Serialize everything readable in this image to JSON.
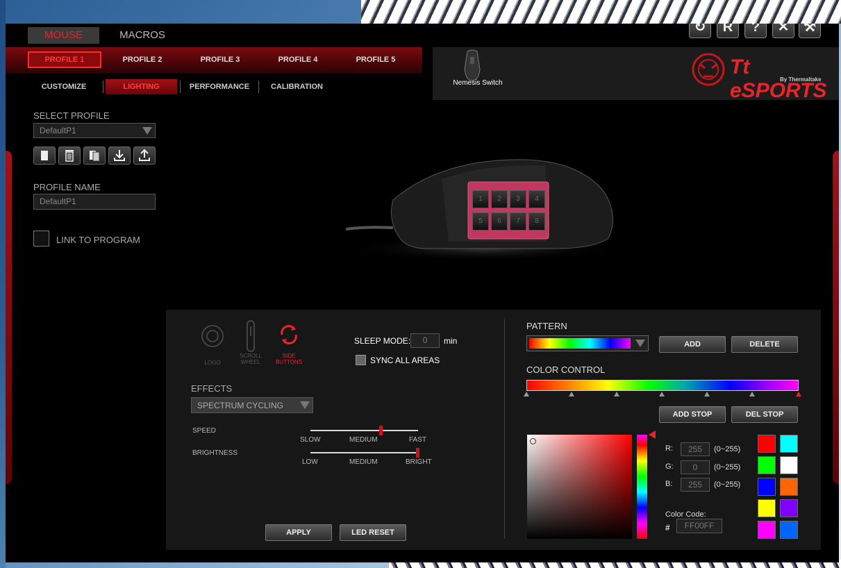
{
  "header": {
    "main_tabs": [
      "MOUSE",
      "MACROS"
    ],
    "profile_tabs": [
      "PROFILE 1",
      "PROFILE 2",
      "PROFILE 3",
      "PROFILE 4",
      "PROFILE 5"
    ],
    "sub_tabs": [
      "CUSTOMIZE",
      "LIGHTING",
      "PERFORMANCE",
      "CALIBRATION"
    ],
    "device_name": "Nemesis Switch",
    "brand": "Tt eSPORTS",
    "brand_byline": "By Thermaltake",
    "toolbar_glyphs": [
      "↻",
      "R",
      "?",
      "✕",
      "⚒"
    ]
  },
  "left": {
    "select_profile_label": "SELECT PROFILE",
    "selected_profile": "DefaultP1",
    "profile_name_label": "PROFILE NAME",
    "profile_name_value": "DefaultP1",
    "link_to_program_label": "LINK TO PROGRAM"
  },
  "mouse_keys": [
    "1",
    "2",
    "3",
    "4",
    "5",
    "6",
    "7",
    "8"
  ],
  "zones": {
    "logo": "LOGO",
    "scroll_wheel": "SCROLL WHEEL",
    "side_buttons": "SIDE BUTTONS"
  },
  "sleep": {
    "label": "SLEEP MODE:",
    "value": "0",
    "unit": "min"
  },
  "sync_all_areas_label": "SYNC ALL AREAS",
  "effects": {
    "label": "EFFECTS",
    "value": "SPECTRUM CYCLING",
    "speed_label": "SPEED",
    "speed_ticks": [
      "SLOW",
      "MEDIUM",
      "FAST"
    ],
    "speed_level": 0.66,
    "brightness_label": "BRIGHTNESS",
    "brightness_ticks": [
      "LOW",
      "MEDIUM",
      "BRIGHT"
    ],
    "brightness_level": 1.0
  },
  "buttons": {
    "apply": "APPLY",
    "led_reset": "LED RESET",
    "add": "ADD",
    "delete": "DELETE",
    "add_stop": "ADD STOP",
    "del_stop": "DEL STOP"
  },
  "pattern": {
    "label": "PATTERN"
  },
  "color_control": {
    "label": "COLOR CONTROL",
    "r_label": "R:",
    "g_label": "G:",
    "b_label": "B:",
    "r": "255",
    "g": "0",
    "b": "255",
    "range": "(0~255)",
    "color_code_label": "Color Code:",
    "hash": "#",
    "color_code": "FF00FF"
  },
  "swatches": [
    "#ff0000",
    "#00ffff",
    "#00ff00",
    "#ffffff",
    "#0000ff",
    "#ff6600",
    "#ffff00",
    "#8000ff",
    "#ff00ff",
    "#0066ff"
  ],
  "colors": {
    "accent": "#e8242a",
    "panel": "#171717"
  }
}
